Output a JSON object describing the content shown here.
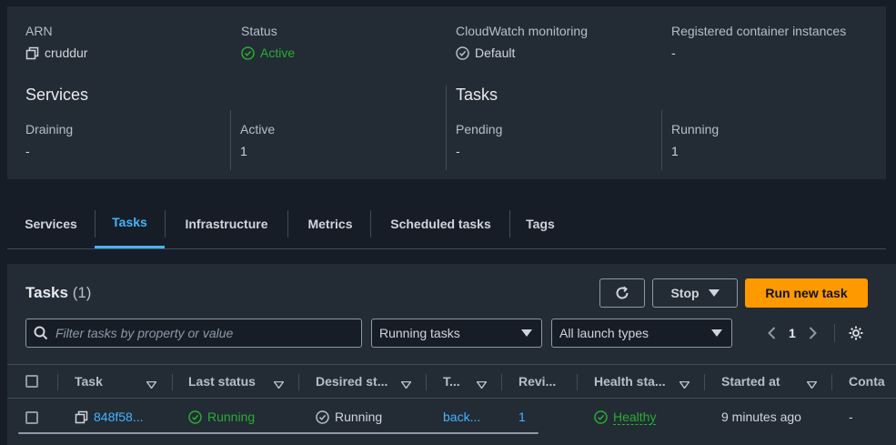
{
  "overview": {
    "arn": {
      "label": "ARN",
      "value": "cruddur",
      "icon": "copy-icon"
    },
    "status": {
      "label": "Status",
      "value": "Active",
      "icon": "check-circle-icon"
    },
    "cloudwatch": {
      "label": "CloudWatch monitoring",
      "value": "Default",
      "icon": "check-circle-icon"
    },
    "registered": {
      "label": "Registered container instances",
      "value": "-"
    },
    "services": {
      "heading": "Services",
      "draining": {
        "label": "Draining",
        "value": "-"
      },
      "active": {
        "label": "Active",
        "value": "1"
      }
    },
    "tasks": {
      "heading": "Tasks",
      "pending": {
        "label": "Pending",
        "value": "-"
      },
      "running": {
        "label": "Running",
        "value": "1"
      }
    }
  },
  "tabs": [
    {
      "label": "Services",
      "active": false
    },
    {
      "label": "Tasks",
      "active": true
    },
    {
      "label": "Infrastructure",
      "active": false
    },
    {
      "label": "Metrics",
      "active": false
    },
    {
      "label": "Scheduled tasks",
      "active": false
    },
    {
      "label": "Tags",
      "active": false
    }
  ],
  "tasks_panel": {
    "title": "Tasks",
    "count": "(1)",
    "refresh_icon": "refresh-icon",
    "stop_label": "Stop",
    "run_label": "Run new task",
    "search_placeholder": "Filter tasks by property or value",
    "filter_status": "Running tasks",
    "filter_launch": "All launch types",
    "page": "1",
    "settings_icon": "gear-icon"
  },
  "table": {
    "columns": [
      "Task",
      "Last status",
      "Desired st...",
      "T...",
      "Revi...",
      "Health sta...",
      "Started at",
      "Conta"
    ],
    "rows": [
      {
        "task": "848f58...",
        "last_status": "Running",
        "desired_status": "Running",
        "task_definition": "back...",
        "revision": "1",
        "health": "Healthy",
        "started_at": "9 minutes ago",
        "container": "-"
      }
    ]
  },
  "colors": {
    "accent": "#42b4ff",
    "primary_button": "#ff9900",
    "success": "#29ad32",
    "panel": "#232b35",
    "background": "#161d26"
  }
}
